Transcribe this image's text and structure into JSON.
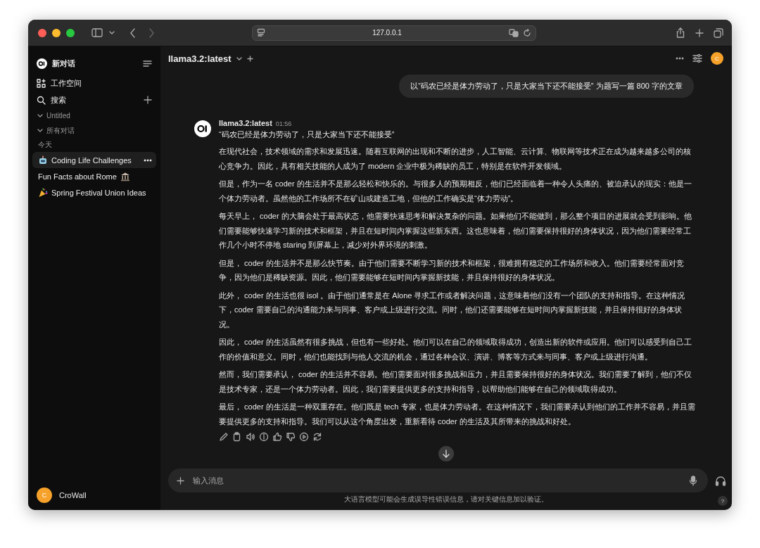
{
  "browser": {
    "url": "127.0.0.1"
  },
  "sidebar": {
    "new_chat": "新对话",
    "nav": [
      {
        "label": "工作空间"
      },
      {
        "label": "搜索"
      }
    ],
    "folders": [
      {
        "label": "Untitled",
        "expanded": true
      },
      {
        "label": "所有对话",
        "expanded": true
      }
    ],
    "section": "今天",
    "chats": [
      {
        "title": "Coding Life Challenges",
        "selected": true
      },
      {
        "title": "Fun Facts about Rome",
        "selected": false
      },
      {
        "title": "Spring Festival Union Ideas",
        "selected": false
      }
    ],
    "user": {
      "initial": "C",
      "name": "CroWall"
    }
  },
  "header": {
    "model": "llama3.2:latest",
    "avatar": "C"
  },
  "messages": [
    {
      "kind": "user",
      "text": "以“码农已经是体力劳动了，只是大家当下还不能接受” 为题写一篇 800 字的文章"
    },
    {
      "kind": "assistant",
      "model": "llama3.2:latest",
      "time": "01:56",
      "title": "“码农已经是体力劳动了，只是大家当下还不能接受”",
      "paragraphs": [
        "在现代社会，技术领域的需求和发展迅速。随着互联网的出现和不断的进步，人工智能、云计算、物联网等技术正在成为越来越多公司的核心竞争力。因此，具有相关技能的人成为了 modern 企业中极为稀缺的员工，特别是在软件开发领域。",
        "但是，作为一名 coder 的生活并不是那么轻松和快乐的。与很多人的预期相反，他们已经面临着一种令人头痛的、被迫承认的现实：他是一个体力劳动者。虽然他的工作场所不在矿山或建造工地，但他的工作确实是“体力劳动”。",
        "每天早上， coder 的大脑会处于最高状态，他需要快速思考和解决复杂的问题。如果他们不能做到，那么整个项目的进展就会受到影响。他们需要能够快速学习新的技术和框架，并且在短时间内掌握这些新东西。这也意味着，他们需要保持很好的身体状况，因为他们需要经常工作几个小时不停地 staring 到屏幕上，减少对外界环境的刺激。",
        "但是， coder 的生活并不是那么快节奏。由于他们需要不断学习新的技术和框架，很难拥有稳定的工作场所和收入。他们需要经常面对竞争，因为他们是稀缺资源。因此，他们需要能够在短时间内掌握新技能，并且保持很好的身体状况。",
        "此外， coder 的生活也很 isol 。由于他们通常是在 Alone 寻求工作或者解决问题，这意味着他们没有一个团队的支持和指导。在这种情况下，coder 需要自己的沟通能力来与同事、客户或上级进行交流。同时，他们还需要能够在短时间内掌握新技能，并且保持很好的身体状况。",
        "因此， coder 的生活虽然有很多挑战，但也有一些好处。他们可以在自己的领域取得成功，创造出新的软件或应用。他们可以感受到自己工作的价值和意义。同时，他们也能找到与他人交流的机会，通过各种会议、演讲、博客等方式来与同事、客户或上级进行沟通。",
        "然而，我们需要承认， coder 的生活并不容易。他们需要面对很多挑战和压力，并且需要保持很好的身体状况。我们需要了解到，他们不仅是技术专家，还是一个体力劳动者。因此，我们需要提供更多的支持和指导，以帮助他们能够在自己的领域取得成功。",
        "最后， coder 的生活是一种双重存在。他们既是 tech 专家，也是体力劳动者。在这种情况下，我们需要承认到他们的工作并不容易，并且需要提供更多的支持和指导。我们可以从这个角度出发，重新看待 coder 的生活及其所带来的挑战和好处。"
      ]
    }
  ],
  "composer": {
    "placeholder": "输入消息"
  },
  "disclaimer": "大语言模型可能会生成误导性错误信息，请对关键信息加以验证。",
  "help": "?"
}
